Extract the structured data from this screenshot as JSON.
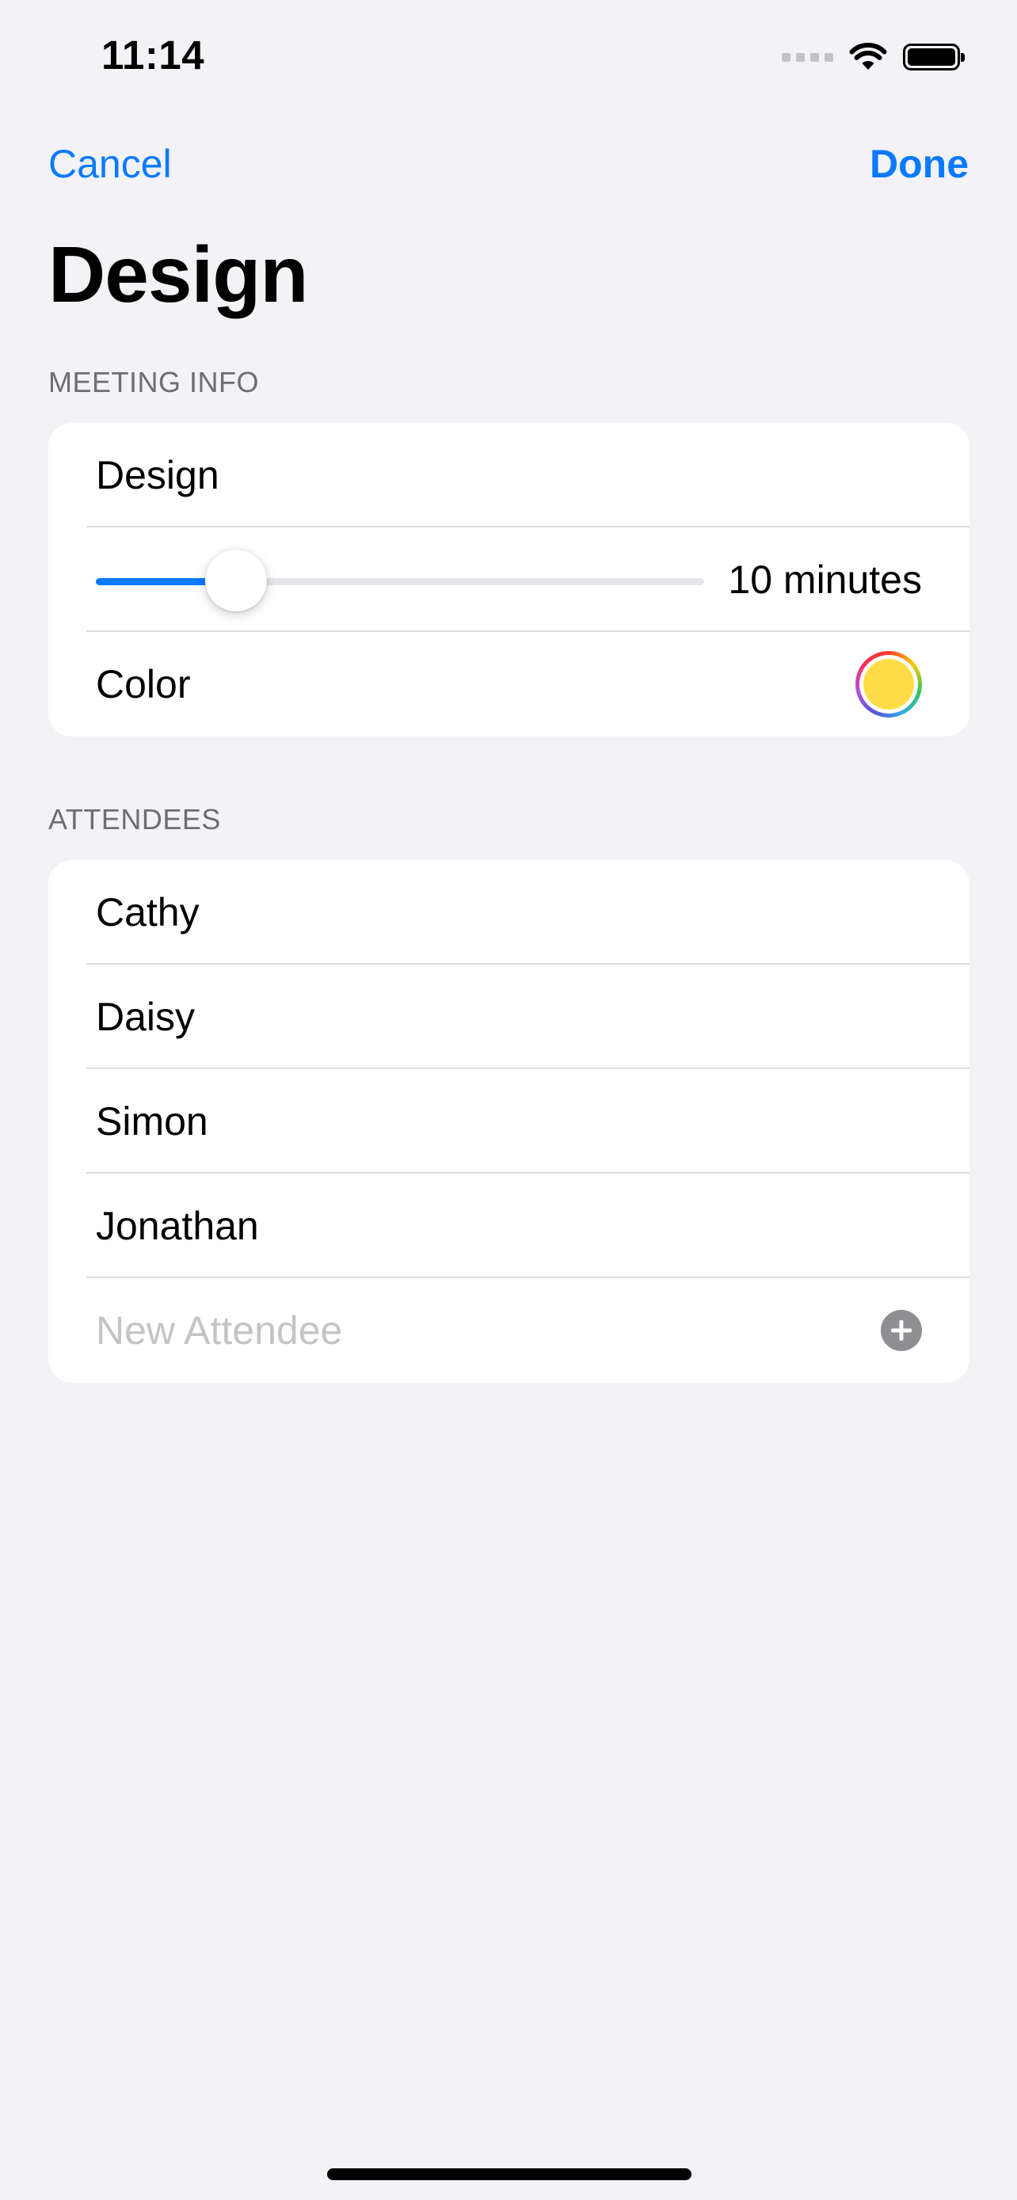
{
  "status_bar": {
    "time": "11:14",
    "icons": [
      "cellular-signal-icon",
      "wifi-icon",
      "battery-icon"
    ]
  },
  "nav": {
    "cancel_label": "Cancel",
    "done_label": "Done"
  },
  "page_title": "Design",
  "meeting_info": {
    "header": "MEETING INFO",
    "title_value": "Design",
    "length": {
      "value_label": "10 minutes",
      "slider_fraction": 0.23
    },
    "color": {
      "label": "Color",
      "value": "#ffdd47"
    }
  },
  "attendees": {
    "header": "ATTENDEES",
    "items": [
      "Cathy",
      "Daisy",
      "Simon",
      "Jonathan"
    ],
    "new_placeholder": "New Attendee",
    "add_icon": "plus-circle-icon"
  },
  "colors": {
    "accent": "#0a7aff",
    "background": "#f2f2f7"
  }
}
